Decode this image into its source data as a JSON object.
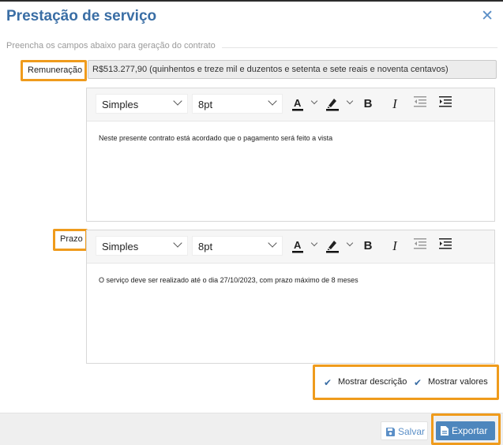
{
  "dialog": {
    "title": "Prestação de serviço",
    "close_icon": "close-icon"
  },
  "section": {
    "label": "Preencha os campos abaixo para geração do contrato"
  },
  "remuneracao": {
    "label": "Remuneração",
    "value": "R$513.277,90 (quinhentos e treze mil e duzentos e setenta e sete reais e noventa centavos)"
  },
  "editor1": {
    "style_select": "Simples",
    "size_select": "8pt",
    "text": "Neste presente contrato está acordado que o pagamento será feito a vista"
  },
  "prazo": {
    "label": "Prazo"
  },
  "editor2": {
    "style_select": "Simples",
    "size_select": "8pt",
    "text": "O serviço deve ser realizado até o dia 27/10/2023, com prazo máximo de 8 meses"
  },
  "options": {
    "mostrar_descricao": "Mostrar descrição",
    "mostrar_valores": "Mostrar valores"
  },
  "footer": {
    "salvar_label": "Salvar",
    "exportar_label": "Exportar"
  },
  "colors": {
    "accent": "#3a6ea5",
    "highlight": "#ef9b1c",
    "export_button": "#4d86bd"
  }
}
